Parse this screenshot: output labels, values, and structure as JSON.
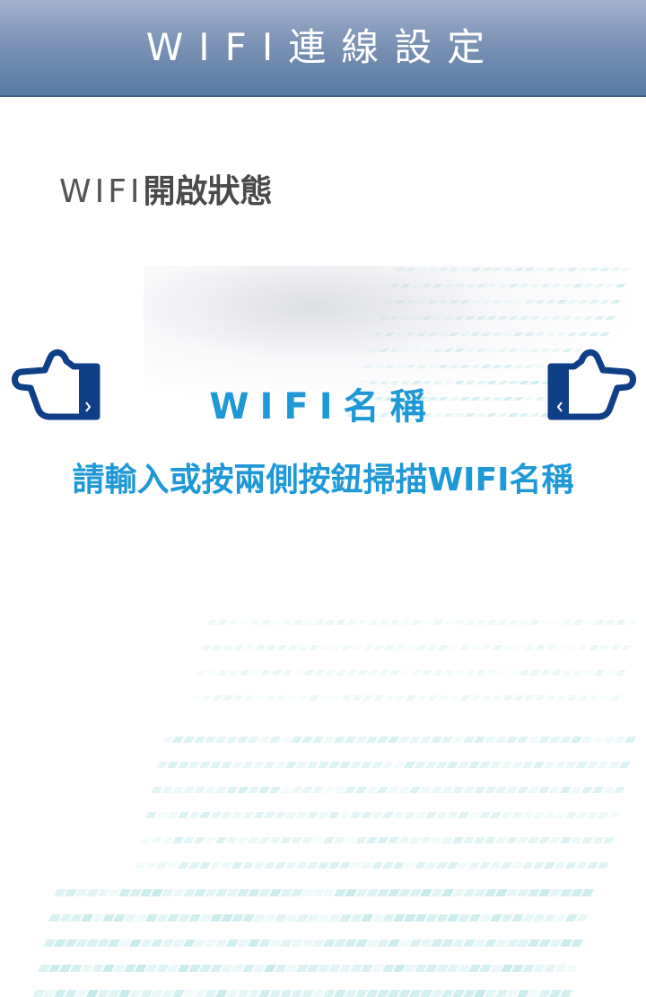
{
  "header": {
    "title": "WIFI連線設定"
  },
  "status": {
    "prefix": "WIFI",
    "label": "開啟狀態"
  },
  "wifi": {
    "name_label": "WIFI名稱",
    "placeholder": "請輸入或按兩側按鈕掃描WIFI名稱",
    "value": ""
  },
  "buttons": {
    "left_icon": "pointing-hand-left-icon",
    "right_icon": "pointing-hand-right-icon"
  },
  "colors": {
    "header_top": "#a3b3cc",
    "header_bottom": "#5a7aa3",
    "accent_blue": "#1e98d6",
    "hand_fill": "#0f3f86",
    "text_gray": "#4a4a4a",
    "streak_teal": "#a8e0e0"
  }
}
